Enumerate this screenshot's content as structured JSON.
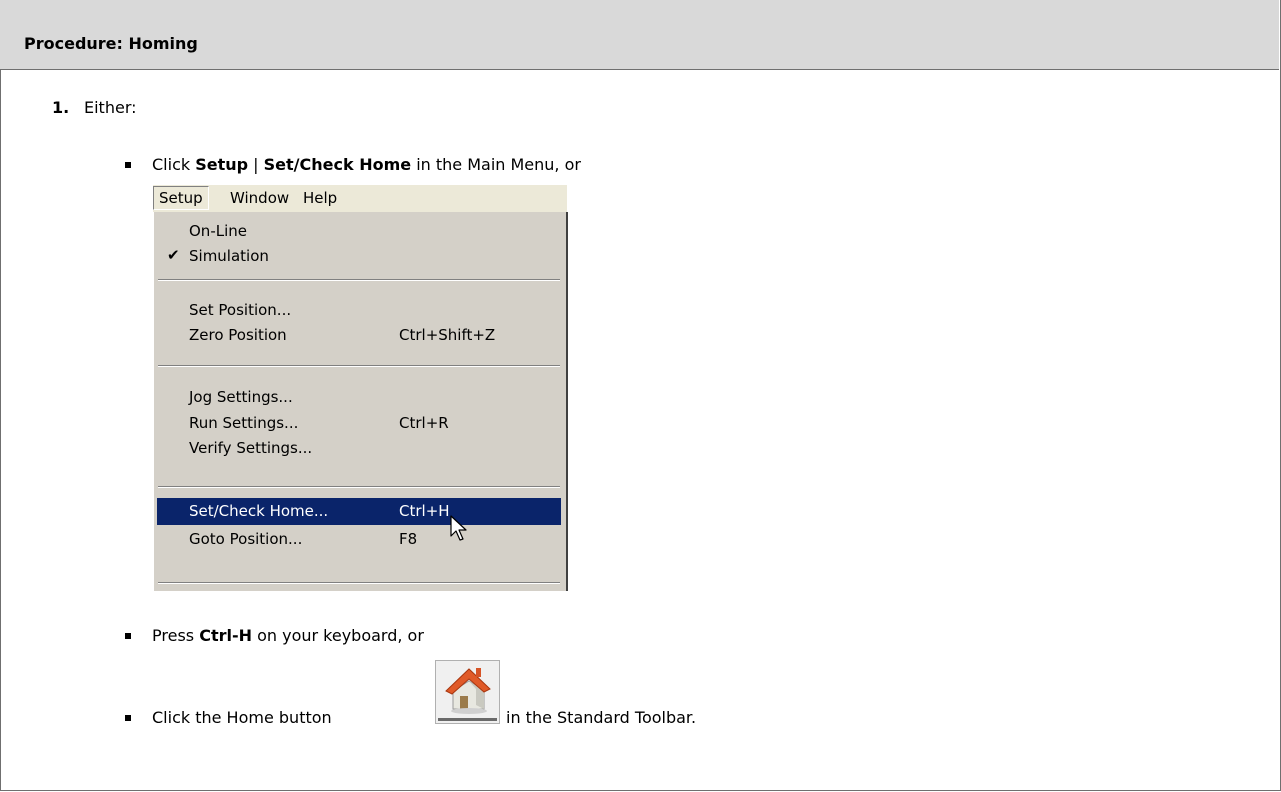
{
  "procedure": {
    "title": "Procedure: Homing"
  },
  "step": {
    "number": "1.",
    "text": "Either:"
  },
  "bullet1": {
    "prefix": "Click ",
    "setup": "Setup",
    "separator": " | ",
    "set_check_home": "Set/Check Home",
    "suffix": " in the Main Menu, or"
  },
  "menubar": {
    "items": [
      "Setup",
      "Window",
      "Help"
    ]
  },
  "menu": {
    "items": [
      {
        "label": "On-Line",
        "shortcut": ""
      },
      {
        "label": "Simulation",
        "shortcut": "",
        "checked": "✔"
      },
      {
        "label": "Set Position...",
        "shortcut": ""
      },
      {
        "label": "Zero Position",
        "shortcut": "Ctrl+Shift+Z"
      },
      {
        "label": "Jog Settings...",
        "shortcut": ""
      },
      {
        "label": "Run Settings...",
        "shortcut": "Ctrl+R"
      },
      {
        "label": "Verify Settings...",
        "shortcut": ""
      },
      {
        "label": "Set/Check Home...",
        "shortcut": "Ctrl+H",
        "selected": true
      },
      {
        "label": "Goto Position...",
        "shortcut": "F8"
      }
    ],
    "selected_color": "#0a246a",
    "background_color": "#d4d0c8"
  },
  "bullet2": {
    "prefix": "Press ",
    "key": "Ctrl-H",
    "suffix": " on your keyboard, or"
  },
  "bullet3": {
    "prefix": "Click the Home button",
    "suffix": " in the Standard Toolbar."
  },
  "icons": {
    "home_button": "home-icon",
    "cursor": "mouse-pointer-icon"
  },
  "colors": {
    "header_bg": "#d9d9d9",
    "border": "#6f6f6f"
  }
}
